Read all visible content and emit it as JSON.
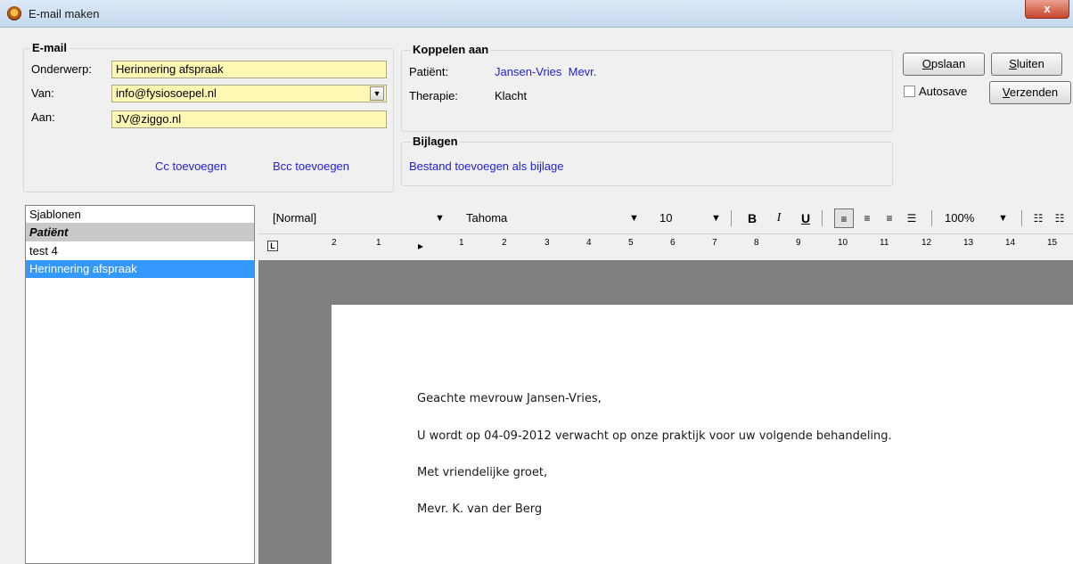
{
  "window": {
    "title": "E-mail maken",
    "close_label": "x"
  },
  "email": {
    "group_label": "E-mail",
    "subject_label": "Onderwerp:",
    "subject_value": "Herinnering afspraak",
    "from_label": "Van:",
    "from_value": "info@fysiosoepel.nl",
    "to_label": "Aan:",
    "to_value": "JV@ziggo.nl",
    "cc_link": "Cc toevoegen",
    "bcc_link": "Bcc toevoegen"
  },
  "link_to": {
    "group_label": "Koppelen aan",
    "patient_label": "Patiënt:",
    "patient_value": "Jansen-Vries  Mevr.",
    "therapy_label": "Therapie:",
    "therapy_value": "Klacht"
  },
  "attachments": {
    "group_label": "Bijlagen",
    "add_link": "Bestand toevoegen als bijlage"
  },
  "actions": {
    "save_hotkey": "O",
    "save_rest": "pslaan",
    "close_hotkey": "S",
    "close_rest": "luiten",
    "send_hotkey": "V",
    "send_rest": "erzenden",
    "autosave_label": "Autosave",
    "autosave_checked": false
  },
  "templates": {
    "header": "Sjablonen",
    "category": "Patiënt",
    "items": [
      "test 4",
      "Herinnering afspraak"
    ],
    "selected_index": 1
  },
  "toolbar": {
    "style": "[Normal]",
    "font": "Tahoma",
    "size": "10",
    "bold": "B",
    "italic": "I",
    "underline": "U",
    "zoom": "100%"
  },
  "ruler": {
    "tab_marker": "L",
    "numbers": [
      "2",
      "1",
      "1",
      "2",
      "3",
      "4",
      "5",
      "6",
      "7",
      "8",
      "9",
      "10",
      "11",
      "12",
      "13",
      "14",
      "15"
    ]
  },
  "document": {
    "lines": [
      " Geachte mevrouw Jansen-Vries,",
      "U wordt op 04-09-2012 verwacht op onze praktijk voor uw volgende behandeling.",
      "Met vriendelijke groet,",
      "Mevr. K. van der Berg"
    ]
  },
  "colors": {
    "input_bg": "#fef8b4",
    "link": "#1f1fdc",
    "selection": "#3399ff"
  }
}
